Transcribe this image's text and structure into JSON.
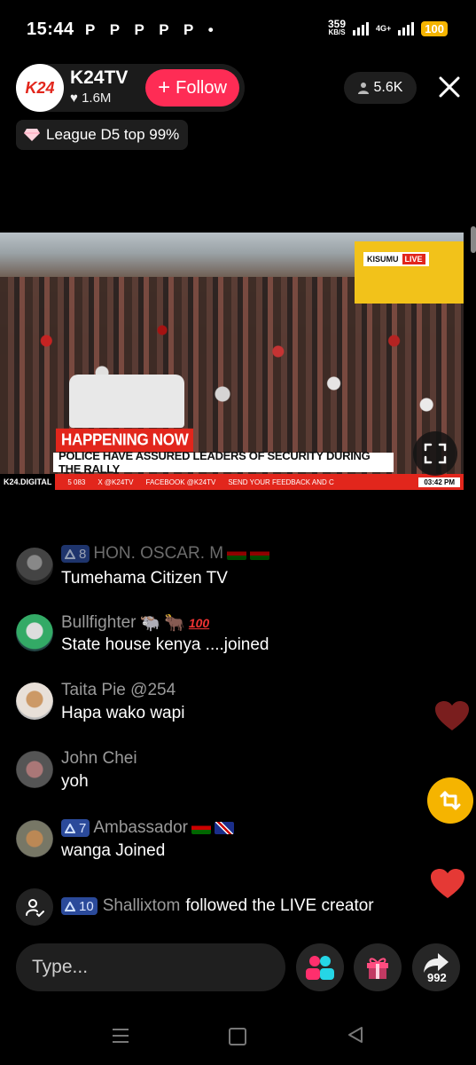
{
  "status_bar": {
    "time": "15:44",
    "notification_icons": "P P P P P •",
    "net_speed_value": "359",
    "net_speed_unit": "KB/S",
    "network_label": "4G+",
    "battery": "100"
  },
  "host": {
    "name": "K24TV",
    "likes": "1.6M",
    "follow_label": "Follow",
    "logo_text": "K24"
  },
  "viewers": {
    "count": "5.6K"
  },
  "league": {
    "label": "League D5 top 99%"
  },
  "video": {
    "location": "KISUMU",
    "live_tag": "LIVE",
    "banner": "HAPPENING NOW",
    "headline": "POLICE HAVE ASSURED LEADERS OF SECURITY DURING THE RALLY",
    "ticker_brand": "K24.DIGITAL",
    "ticker_items": [
      "5 083",
      "X @K24TV",
      "FACEBOOK @K24TV",
      "SEND YOUR FEEDBACK AND C"
    ],
    "clock": "03:42 PM"
  },
  "comments": [
    {
      "user": "HON. OSCAR. M",
      "level": "8",
      "text": "Tumehama Citizen TV"
    },
    {
      "user": "Bullfighter",
      "level": "",
      "text": "State house kenya ....joined"
    },
    {
      "user": "Taita Pie @254",
      "level": "",
      "text": "Hapa wako wapi"
    },
    {
      "user": "John Chei",
      "level": "",
      "text": "yoh"
    },
    {
      "user": "Ambassador",
      "level": "7",
      "text": "wanga Joined"
    }
  ],
  "system_message": {
    "level": "10",
    "user": "Shallixtom",
    "text": "followed the LIVE creator"
  },
  "bottom": {
    "input_placeholder": "Type...",
    "share_count": "992"
  },
  "colors": {
    "accent": "#fe2c55",
    "level_badge": "#2b4a9a",
    "repost": "#f5b400",
    "heart": "#e53935"
  }
}
